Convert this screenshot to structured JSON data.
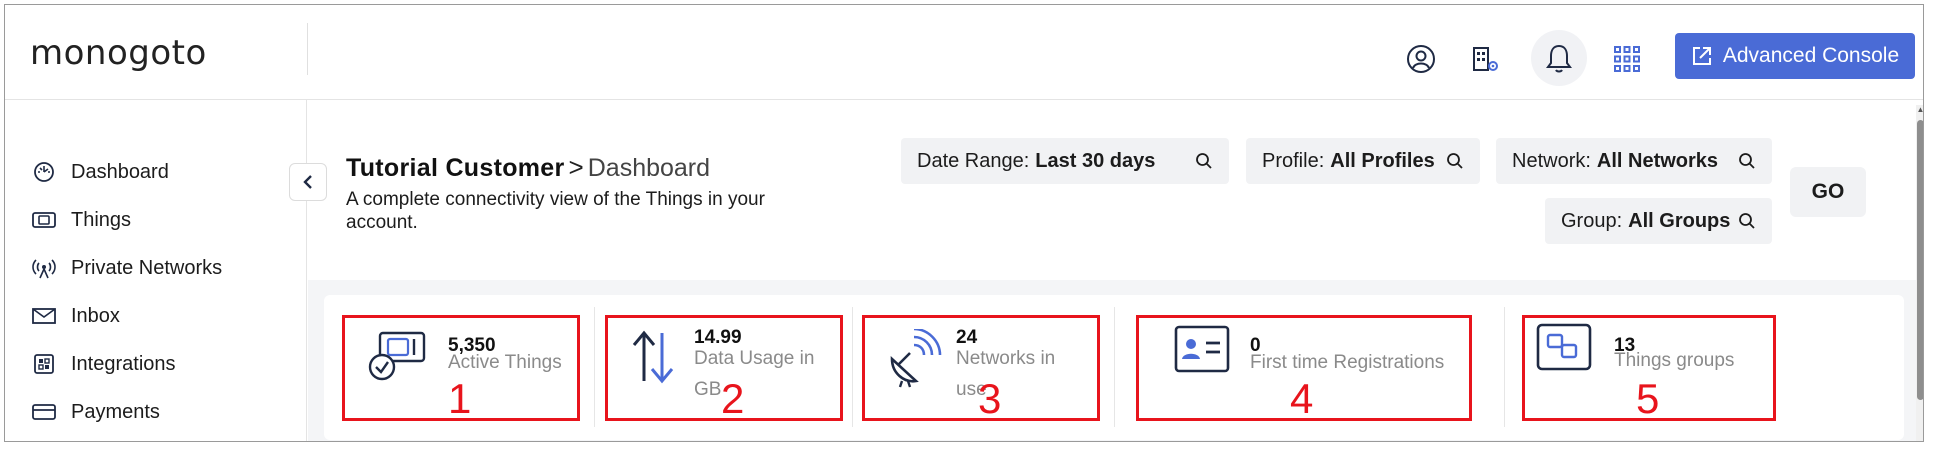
{
  "header": {
    "logo_text": "monogoto",
    "advanced_console_label": "Advanced Console",
    "icons": [
      "user-circle-icon",
      "building-settings-icon",
      "bell-icon",
      "apps-grid-icon",
      "external-link-icon"
    ]
  },
  "sidebar": {
    "items": [
      {
        "label": "Dashboard",
        "icon": "dashboard-icon"
      },
      {
        "label": "Things",
        "icon": "sim-card-icon"
      },
      {
        "label": "Private Networks",
        "icon": "antenna-icon"
      },
      {
        "label": "Inbox",
        "icon": "mail-icon"
      },
      {
        "label": "Integrations",
        "icon": "integrations-icon"
      },
      {
        "label": "Payments",
        "icon": "credit-card-icon"
      }
    ]
  },
  "page": {
    "breadcrumb_root": "Tutorial Customer",
    "breadcrumb_sep": ">",
    "breadcrumb_page": "Dashboard",
    "subtitle": "A complete connectivity view of the Things in your account."
  },
  "filters": {
    "date_range": {
      "key": "Date Range:",
      "value": "Last 30 days"
    },
    "profile": {
      "key": "Profile:",
      "value": "All Profiles"
    },
    "network": {
      "key": "Network:",
      "value": "All Networks"
    },
    "group": {
      "key": "Group:",
      "value": "All Groups"
    },
    "go_label": "GO"
  },
  "stats": [
    {
      "value": "5,350",
      "label": "Active Things",
      "annotation": "1"
    },
    {
      "value": "14.99",
      "label_line1": "Data Usage in",
      "label_line2": "GB",
      "annotation": "2"
    },
    {
      "value": "24",
      "label_line1": "Networks in",
      "label_line2": "use",
      "annotation": "3"
    },
    {
      "value": "0",
      "label": "First time Registrations",
      "annotation": "4"
    },
    {
      "value": "13",
      "label": "Things groups",
      "annotation": "5"
    }
  ],
  "colors": {
    "accent": "#4a6bd6",
    "annotation_red": "#e8141c",
    "icon_dark": "#1f2a44",
    "icon_blue": "#4a6bd6"
  }
}
